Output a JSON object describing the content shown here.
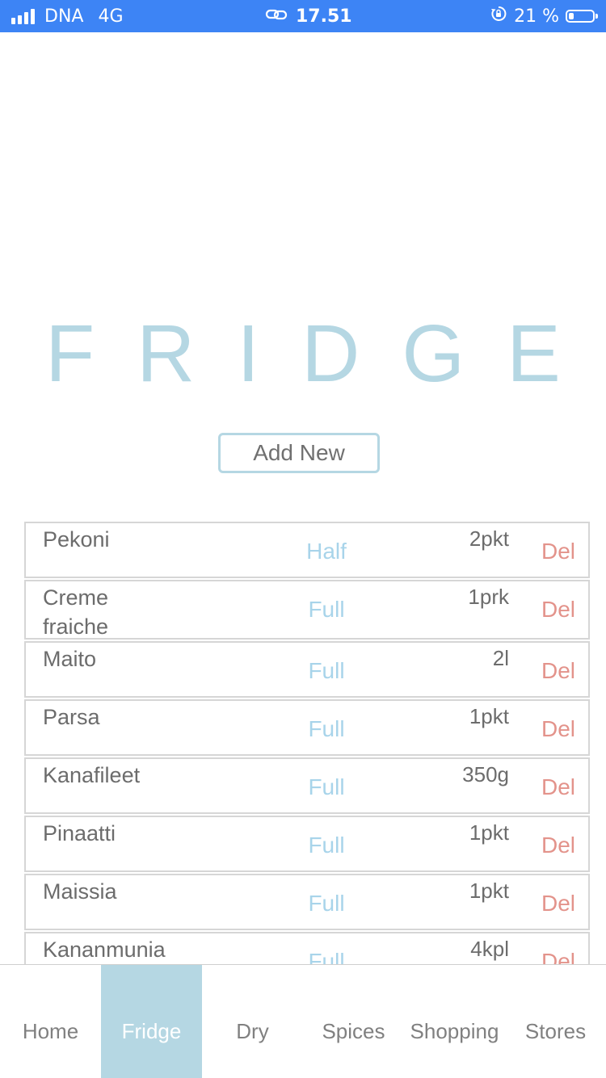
{
  "status_bar": {
    "carrier": "DNA",
    "network": "4G",
    "time": "17.51",
    "battery": "21 %",
    "battery_level": 0.21
  },
  "page": {
    "title": "FRIDGE",
    "add_button": "Add New"
  },
  "items": [
    {
      "name": "Pekoni",
      "status": "Half",
      "quantity": "2pkt",
      "delete": "Del"
    },
    {
      "name": "Creme fraiche",
      "status": "Full",
      "quantity": "1prk",
      "delete": "Del"
    },
    {
      "name": "Maito",
      "status": "Full",
      "quantity": "2l",
      "delete": "Del"
    },
    {
      "name": "Parsa",
      "status": "Full",
      "quantity": "1pkt",
      "delete": "Del"
    },
    {
      "name": "Kanafileet",
      "status": "Full",
      "quantity": "350g",
      "delete": "Del"
    },
    {
      "name": "Pinaatti",
      "status": "Full",
      "quantity": "1pkt",
      "delete": "Del"
    },
    {
      "name": "Maissia",
      "status": "Full",
      "quantity": "1pkt",
      "delete": "Del"
    },
    {
      "name": "Kananmunia",
      "status": "Full",
      "quantity": "4kpl",
      "delete": "Del"
    }
  ],
  "nav": {
    "tabs": [
      {
        "label": "Home"
      },
      {
        "label": "Fridge",
        "active": true
      },
      {
        "label": "Dry"
      },
      {
        "label": "Spices"
      },
      {
        "label": "Shopping"
      },
      {
        "label": "Stores"
      }
    ]
  },
  "colors": {
    "status_bar": "#3d84f5",
    "accent": "#b5d7e3",
    "status_text": "#a8d4ea",
    "delete_text": "#e3938b"
  },
  "icons": {
    "signal": "signal-icon",
    "link": "link-icon",
    "lock": "rotation-lock-icon",
    "battery": "battery-icon"
  }
}
